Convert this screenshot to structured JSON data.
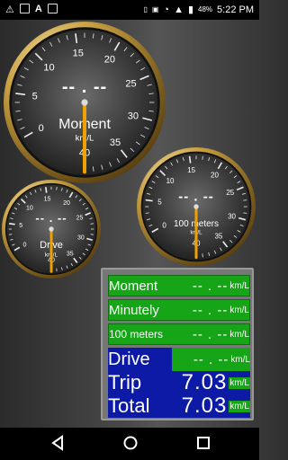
{
  "status": {
    "battery": "48%",
    "time": "5:22 PM"
  },
  "gauges": [
    {
      "name": "moment",
      "label": "Moment",
      "unit": "km/L",
      "reading": "-- . --",
      "ticks": [
        "0",
        "5",
        "10",
        "15",
        "20",
        "25",
        "30",
        "35",
        "40"
      ]
    },
    {
      "name": "100meters",
      "label": "100 meters",
      "unit": "km/L",
      "reading": "-- . --",
      "ticks": [
        "0",
        "5",
        "10",
        "15",
        "20",
        "25",
        "30",
        "35",
        "40"
      ]
    },
    {
      "name": "drive",
      "label": "Drive",
      "unit": "km/L",
      "reading": "-- . --",
      "ticks": [
        "0",
        "5",
        "10",
        "15",
        "20",
        "25",
        "30",
        "35",
        "40"
      ]
    }
  ],
  "rows": [
    {
      "label": "Moment",
      "value": "-- . --",
      "unit": "km/L"
    },
    {
      "label": "Minutely",
      "value": "-- . --",
      "unit": "km/L"
    },
    {
      "label": "100 meters",
      "value": "-- . --",
      "unit": "km/L"
    },
    {
      "label": "Drive",
      "value": "-- . --",
      "unit": "km/L"
    },
    {
      "label": "Trip",
      "value": "7.03",
      "unit": "km/L"
    },
    {
      "label": "Total",
      "value": "7.03",
      "unit": "km/L"
    }
  ],
  "colors": {
    "green": "#16a516",
    "blue": "#0c1aa6",
    "needle": "#f0a000",
    "gold": "#c8a040"
  },
  "icons": [
    "warning-icon",
    "image-icon",
    "a-icon",
    "box-icon",
    "signal-icon",
    "wifi-icon",
    "battery-icon",
    "back-icon",
    "home-icon",
    "recent-icon"
  ]
}
